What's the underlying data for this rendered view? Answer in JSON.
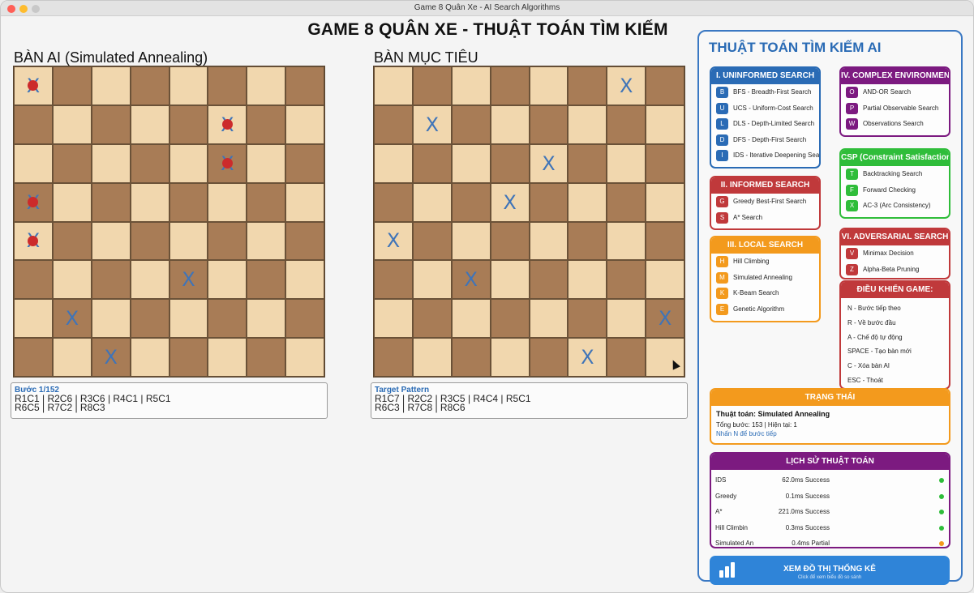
{
  "window": {
    "title": "Game 8 Quân Xe - AI Search Algorithms"
  },
  "main_title": "GAME 8 QUÂN XE - THUẬT TOÁN TÌM KIẾM",
  "boards": {
    "ai": {
      "label": "BÀN AI (Simulated Annealing)",
      "rook_symbol": "X",
      "rooks": [
        [
          1,
          1
        ],
        [
          2,
          6
        ],
        [
          3,
          6
        ],
        [
          4,
          1
        ],
        [
          5,
          1
        ],
        [
          6,
          5
        ],
        [
          7,
          2
        ],
        [
          8,
          3
        ]
      ],
      "conflicts": [
        [
          1,
          1
        ],
        [
          2,
          6
        ],
        [
          3,
          6
        ],
        [
          4,
          1
        ],
        [
          5,
          1
        ]
      ],
      "info_title": "Bước 1/152",
      "info_line1": "R1C1 | R2C6 | R3C6 | R4C1 | R5C1",
      "info_line2": "R6C5 | R7C2 | R8C3"
    },
    "target": {
      "label": "BÀN MỤC TIÊU",
      "rook_symbol": "X",
      "rooks": [
        [
          1,
          7
        ],
        [
          2,
          2
        ],
        [
          3,
          5
        ],
        [
          4,
          4
        ],
        [
          5,
          1
        ],
        [
          6,
          3
        ],
        [
          7,
          8
        ],
        [
          8,
          6
        ]
      ],
      "info_title": "Target Pattern",
      "info_line1": "R1C7 | R2C2 | R3C5 | R4C4 | R5C1",
      "info_line2": "R6C3 | R7C8 | R8C6"
    }
  },
  "panel": {
    "title": "THUẬT TOÁN TÌM KIẾM AI",
    "uninformed": {
      "header": "I. UNINFORMED SEARCH",
      "items": [
        {
          "key": "B",
          "label": "BFS - Breadth-First Search"
        },
        {
          "key": "U",
          "label": "UCS - Uniform-Cost Search"
        },
        {
          "key": "L",
          "label": "DLS - Depth-Limited Search"
        },
        {
          "key": "D",
          "label": "DFS - Depth-First Search"
        },
        {
          "key": "I",
          "label": "IDS - Iterative Deepening Search"
        }
      ]
    },
    "informed": {
      "header": "II. INFORMED SEARCH",
      "items": [
        {
          "key": "G",
          "label": "Greedy Best-First Search"
        },
        {
          "key": "S",
          "label": "A* Search"
        }
      ]
    },
    "local": {
      "header": "III. LOCAL SEARCH",
      "items": [
        {
          "key": "H",
          "label": "Hill Climbing"
        },
        {
          "key": "M",
          "label": "Simulated Annealing"
        },
        {
          "key": "K",
          "label": "K-Beam Search"
        },
        {
          "key": "E",
          "label": "Genetic Algorithm"
        }
      ]
    },
    "complex": {
      "header": "IV. COMPLEX ENVIRONMENT",
      "items": [
        {
          "key": "O",
          "label": "AND-OR Search"
        },
        {
          "key": "P",
          "label": "Partial Observable Search"
        },
        {
          "key": "W",
          "label": "Observations Search"
        }
      ]
    },
    "csp": {
      "header": "CSP (Constraint Satisfaction",
      "items": [
        {
          "key": "T",
          "label": "Backtracking Search"
        },
        {
          "key": "F",
          "label": "Forward Checking"
        },
        {
          "key": "X",
          "label": "AC-3 (Arc Consistency)"
        }
      ]
    },
    "adversarial": {
      "header": "VI. ADVERSARIAL SEARCH",
      "items": [
        {
          "key": "V",
          "label": "Minimax Decision"
        },
        {
          "key": "Z",
          "label": "Alpha-Beta Pruning"
        }
      ]
    },
    "controls": {
      "header": "ĐIỀU KHIỂN GAME:",
      "items": [
        "N - Bước tiếp theo",
        "R - Về bước đầu",
        "A - Chế độ tự động",
        "SPACE - Tạo bàn mới",
        "C - Xóa bàn AI",
        "ESC - Thoát"
      ]
    },
    "status": {
      "header": "TRẠNG THÁI",
      "algorithm": "Thuật toán: Simulated Annealing",
      "steps": "Tổng bước: 153 | Hiện tại: 1",
      "hint": "Nhấn N để bước tiếp"
    },
    "history": {
      "header": "LỊCH SỬ THUẬT TOÁN",
      "rows": [
        {
          "name": "IDS",
          "time": "62.0ms",
          "result": "Success",
          "color": "#2fbd3a"
        },
        {
          "name": "Greedy",
          "time": "0.1ms",
          "result": "Success",
          "color": "#2fbd3a"
        },
        {
          "name": "A*",
          "time": "221.0ms",
          "result": "Success",
          "color": "#2fbd3a"
        },
        {
          "name": "Hill Climbin",
          "time": "0.3ms",
          "result": "Success",
          "color": "#2fbd3a"
        },
        {
          "name": "Simulated An",
          "time": "0.4ms",
          "result": "Partial",
          "color": "#f39a1d"
        }
      ]
    },
    "stats_button": {
      "label": "XEM ĐỒ THỊ THỐNG KÊ",
      "sub": "Click để xem biểu đồ so sánh"
    }
  }
}
